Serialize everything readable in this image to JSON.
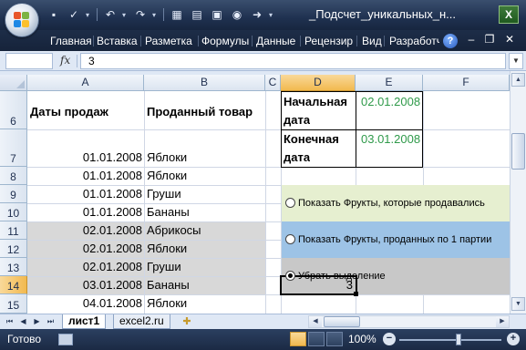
{
  "window": {
    "title": "_Подсчет_уникальных_н...",
    "app_badge": "X"
  },
  "quick_access": [
    "save-icon",
    "spellcheck-icon",
    "undo-icon",
    "redo-icon",
    "form-icon",
    "filter-icon",
    "chart-icon",
    "options-icon",
    "forward-icon"
  ],
  "ribbon": {
    "tabs": [
      "Главная",
      "Вставка",
      "Разметка",
      "Формулы",
      "Данные",
      "Рецензир",
      "Вид",
      "Разработч"
    ],
    "help": "?"
  },
  "formula_bar": {
    "name_box": "",
    "fx": "fx",
    "value": "3"
  },
  "grid": {
    "columns": [
      "A",
      "B",
      "C",
      "D",
      "E",
      "F"
    ],
    "active_column": "D",
    "rows": [
      "6",
      "7",
      "8",
      "9",
      "10",
      "11",
      "12",
      "13",
      "14",
      "15"
    ],
    "active_row": "14",
    "header_a": "Даты продаж",
    "header_b": "Проданный товар",
    "data": [
      {
        "date": "01.01.2008",
        "item": "Яблоки"
      },
      {
        "date": "01.01.2008",
        "item": "Яблоки"
      },
      {
        "date": "01.01.2008",
        "item": "Груши"
      },
      {
        "date": "01.01.2008",
        "item": "Бананы"
      },
      {
        "date": "02.01.2008",
        "item": "Абрикосы"
      },
      {
        "date": "02.01.2008",
        "item": "Яблоки"
      },
      {
        "date": "02.01.2008",
        "item": "Груши"
      },
      {
        "date": "03.01.2008",
        "item": "Бананы"
      },
      {
        "date": "04.01.2008",
        "item": "Яблоки"
      }
    ],
    "start_label_line1": "Начальная",
    "start_label_line2": "дата",
    "start_value": "02.01.2008",
    "end_label_line1": "Конечная",
    "end_label_line2": "дата",
    "end_value": "03.01.2008",
    "result_value": "3"
  },
  "options": [
    {
      "label": "Показать Фрукты, которые продавались",
      "selected": false
    },
    {
      "label": "Показать Фрукты, проданных по 1 партии",
      "selected": false
    },
    {
      "label": "Убрать выделение",
      "selected": true
    }
  ],
  "sheets": {
    "tabs": [
      "лист1",
      "excel2.ru"
    ],
    "active": "лист1"
  },
  "status": {
    "text": "Готово",
    "zoom": "100%"
  },
  "colors": {
    "green_values": "#2f9a4a",
    "option1_bg": "#e6efd0",
    "option2_bg": "#9dc3e6",
    "option3_bg": "#c8c8c8",
    "highlight_rows": "#d8d8d8"
  }
}
